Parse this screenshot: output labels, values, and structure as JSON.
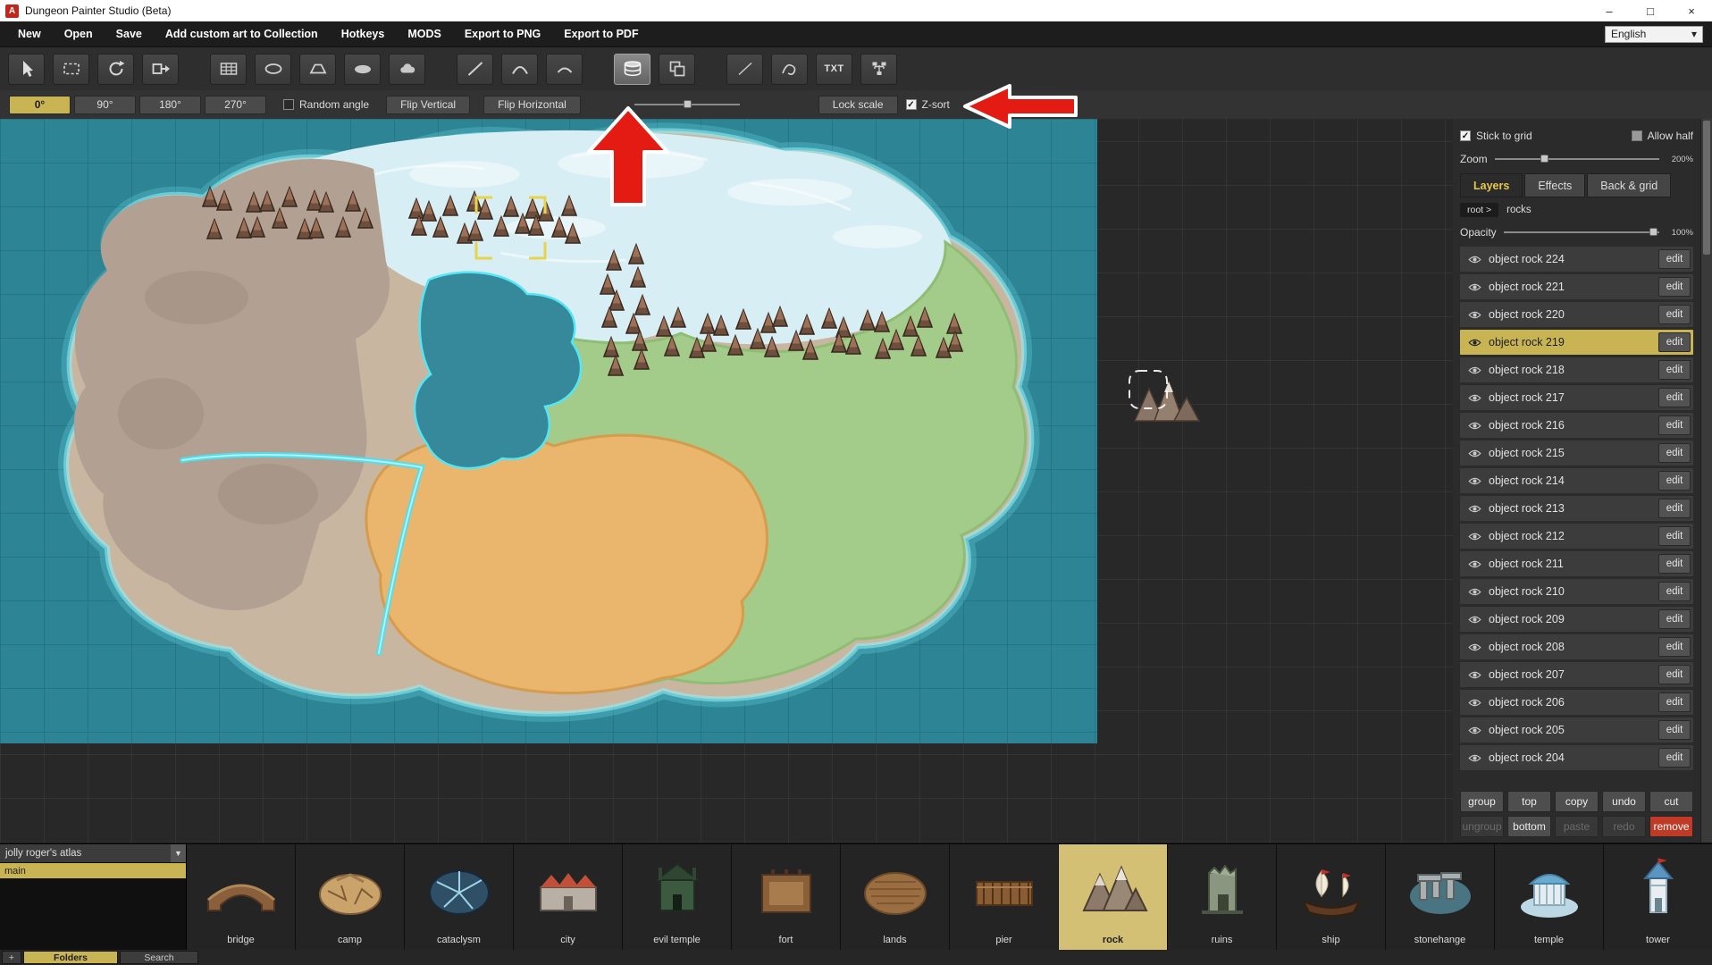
{
  "window": {
    "title": "Dungeon Painter Studio (Beta)",
    "icon_glyph": "A",
    "controls": {
      "minimize": "–",
      "maximize": "□",
      "close": "×"
    }
  },
  "menu": {
    "items": [
      "New",
      "Open",
      "Save",
      "Add custom art to Collection",
      "Hotkeys",
      "MODS",
      "Export to PNG",
      "Export to PDF"
    ],
    "language": "English"
  },
  "toolbar": {
    "txt_label": "TXT"
  },
  "options": {
    "rotations": [
      {
        "label": "0°",
        "active": true
      },
      {
        "label": "90°",
        "active": false
      },
      {
        "label": "180°",
        "active": false
      },
      {
        "label": "270°",
        "active": false
      }
    ],
    "random_angle_label": "Random angle",
    "random_angle_checked": false,
    "flip_vertical_label": "Flip Vertical",
    "flip_horizontal_label": "Flip Horizontal",
    "scale_slider_pct": 50,
    "lock_scale_label": "Lock scale",
    "z_sort_label": "Z-sort",
    "z_sort_checked": true
  },
  "right_panel": {
    "stick_to_grid": {
      "label": "Stick to grid",
      "checked": true
    },
    "allow_half": {
      "label": "Allow half",
      "checked": false
    },
    "zoom": {
      "label": "Zoom",
      "value": "200%",
      "handle_pct": 30
    },
    "tabs": [
      {
        "label": "Layers",
        "active": true
      },
      {
        "label": "Effects",
        "active": false
      },
      {
        "label": "Back & grid",
        "active": false
      }
    ],
    "breadcrumb": {
      "root": "root >",
      "current": "rocks"
    },
    "opacity": {
      "label": "Opacity",
      "value": "100%",
      "handle_pct": 96
    },
    "layers": {
      "edit_label": "edit",
      "selected": "object rock 219",
      "items": [
        "object rock 224",
        "object rock 221",
        "object rock 220",
        "object rock 219",
        "object rock 218",
        "object rock 217",
        "object rock 216",
        "object rock 215",
        "object rock 214",
        "object rock 213",
        "object rock 212",
        "object rock 211",
        "object rock 210",
        "object rock 209",
        "object rock 208",
        "object rock 207",
        "object rock 206",
        "object rock 205",
        "object rock 204"
      ]
    },
    "actions": [
      {
        "label": "group"
      },
      {
        "label": "top"
      },
      {
        "label": "copy"
      },
      {
        "label": "undo"
      },
      {
        "label": "cut"
      },
      {
        "label": "ungroup",
        "disabled": true
      },
      {
        "label": "bottom"
      },
      {
        "label": "paste",
        "disabled": true
      },
      {
        "label": "redo",
        "disabled": true
      },
      {
        "label": "remove",
        "danger": true
      }
    ],
    "accent_color": "#c9b454",
    "danger_color": "#c03a28"
  },
  "palette": {
    "atlas": "jolly roger's atlas",
    "folders": [
      {
        "label": "main",
        "selected": true
      }
    ],
    "add_label": "+",
    "folders_label": "Folders",
    "search_label": "Search",
    "assets": [
      {
        "name": "bridge"
      },
      {
        "name": "camp"
      },
      {
        "name": "cataclysm"
      },
      {
        "name": "city"
      },
      {
        "name": "evil temple"
      },
      {
        "name": "fort"
      },
      {
        "name": "lands"
      },
      {
        "name": "pier"
      },
      {
        "name": "rock",
        "selected": true
      },
      {
        "name": "ruins"
      },
      {
        "name": "ship"
      },
      {
        "name": "stonehange"
      },
      {
        "name": "temple"
      },
      {
        "name": "tower"
      }
    ]
  }
}
